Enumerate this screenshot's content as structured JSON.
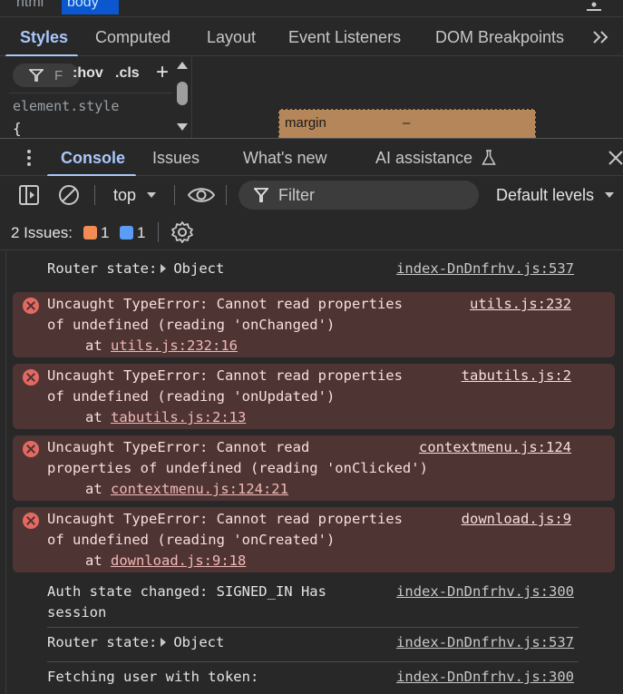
{
  "breadcrumb": {
    "items": [
      "html",
      "body"
    ]
  },
  "elements_tabs": [
    "Styles",
    "Computed",
    "Layout",
    "Event Listeners",
    "DOM Breakpoints"
  ],
  "styles": {
    "filter_placeholder": "F",
    "hov": ":hov",
    "cls": ".cls",
    "element_style": "element.style",
    "brace": "{"
  },
  "boxmodel": {
    "label": "margin",
    "value": "–"
  },
  "drawer_tabs": [
    "Console",
    "Issues",
    "What's new",
    "AI assistance"
  ],
  "toolbar": {
    "context": "top",
    "filter_placeholder": "Filter",
    "levels": "Default levels"
  },
  "issues": {
    "label": "2 Issues:",
    "errors": "1",
    "info": "1"
  },
  "messages": [
    {
      "type": "log",
      "text": "Router state:",
      "object": "Object",
      "source": "index-DnDnfrhv.js:537"
    },
    {
      "type": "error",
      "line1": "Uncaught TypeError: Cannot read properties",
      "line2": "of undefined (reading 'onChanged')",
      "at": "at ",
      "at_link": "utils.js:232:16",
      "source": "utils.js:232"
    },
    {
      "type": "error",
      "line1": "Uncaught TypeError: Cannot read properties",
      "line2": "of undefined (reading 'onUpdated')",
      "at": "at ",
      "at_link": "tabutils.js:2:13",
      "source": "tabutils.js:2"
    },
    {
      "type": "error",
      "line1": "Uncaught TypeError: Cannot read",
      "line2": "properties of undefined (reading 'onClicked')",
      "at": "at ",
      "at_link": "contextmenu.js:124:21",
      "source": "contextmenu.js:124"
    },
    {
      "type": "error",
      "line1": "Uncaught TypeError: Cannot read properties",
      "line2": "of undefined (reading 'onCreated')",
      "at": "at ",
      "at_link": "download.js:9:18",
      "source": "download.js:9"
    },
    {
      "type": "log",
      "line1": "Auth state changed: SIGNED_IN Has",
      "line2": "session",
      "source": "index-DnDnfrhv.js:300"
    },
    {
      "type": "log",
      "text": "Router state:",
      "object": "Object",
      "source": "index-DnDnfrhv.js:537"
    },
    {
      "type": "log",
      "text": "Fetching user with token:",
      "source": "index-DnDnfrhv.js:300"
    }
  ],
  "colors": {
    "accent": "#a8c7fa",
    "error_bg": "#4e3534",
    "error_icon": "#e46962",
    "panel_bg": "#282828"
  }
}
